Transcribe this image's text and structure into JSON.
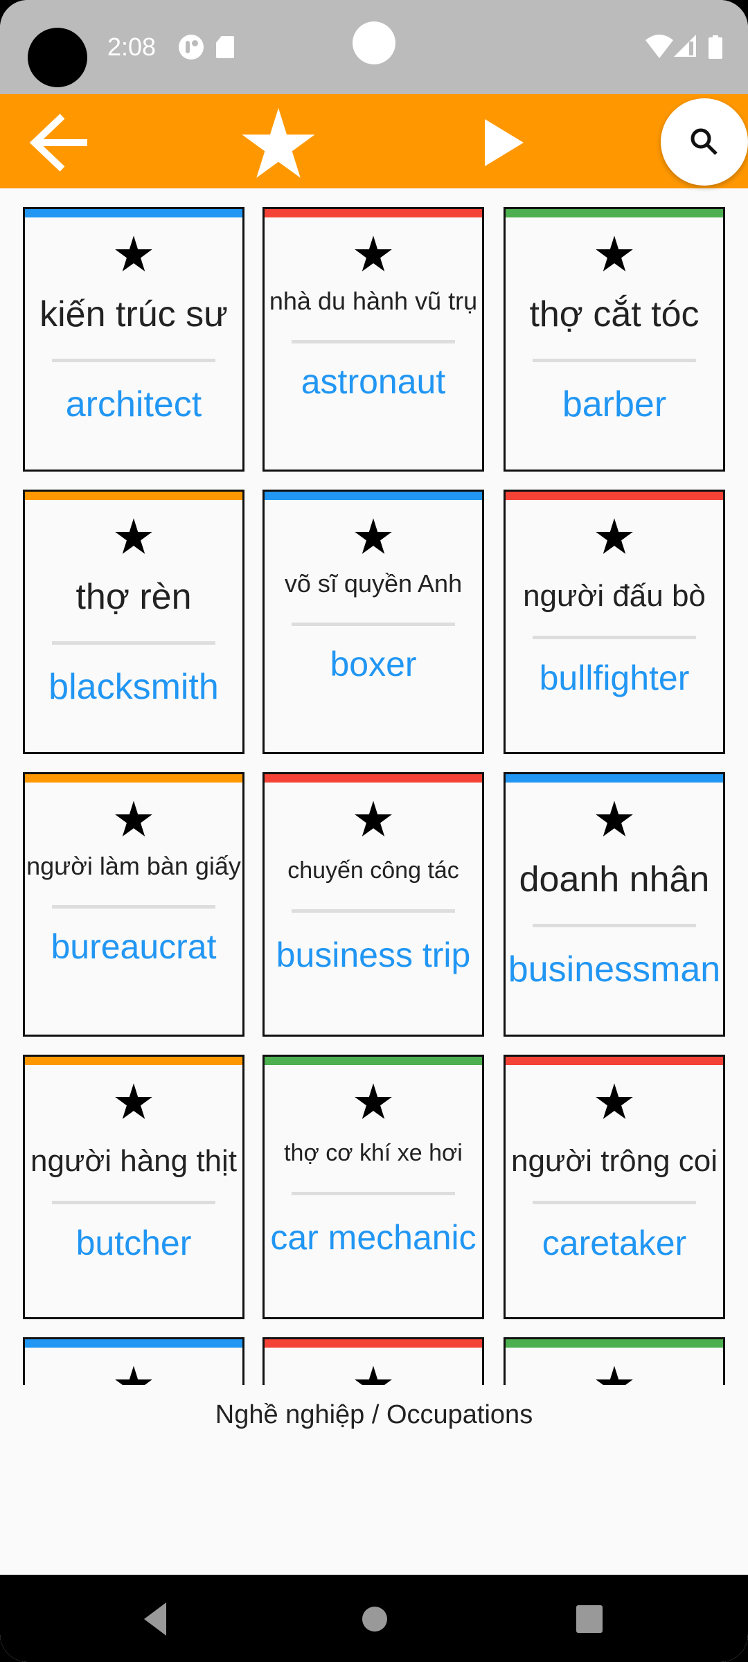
{
  "status_bar": {
    "time": "2:08",
    "icons": [
      "app-notification-icon",
      "sd-card-icon",
      "wifi-icon",
      "cell-signal-icon",
      "battery-icon"
    ]
  },
  "toolbar": {
    "back_icon": "arrow-left-icon",
    "favorite_icon": "star-icon",
    "play_icon": "play-icon",
    "search_icon": "search-icon",
    "background_color": "#FF9800"
  },
  "colors": {
    "blue": "#2196F3",
    "red": "#F44336",
    "green": "#4CAF50",
    "orange": "#FF9800",
    "english_text": "#2196F3"
  },
  "cards": [
    {
      "vi": "kiến trúc sư",
      "en": "architect",
      "color": "#2196F3",
      "size": "l"
    },
    {
      "vi": "nhà du hành vũ trụ",
      "en": "astronaut",
      "color": "#F44336",
      "size": "s"
    },
    {
      "vi": "thợ cắt tóc",
      "en": "barber",
      "color": "#4CAF50",
      "size": "l"
    },
    {
      "vi": "thợ rèn",
      "en": "blacksmith",
      "color": "#FF9800",
      "size": "l"
    },
    {
      "vi": "võ sĩ quyền Anh",
      "en": "boxer",
      "color": "#2196F3",
      "size": "s"
    },
    {
      "vi": "người đấu bò",
      "en": "bullfighter",
      "color": "#F44336",
      "size": "m"
    },
    {
      "vi": "người làm bàn giấy",
      "en": "bureaucrat",
      "color": "#FF9800",
      "size": "s"
    },
    {
      "vi": "chuyến công tác",
      "en": "business trip",
      "color": "#F44336",
      "size": "xs"
    },
    {
      "vi": "doanh nhân",
      "en": "businessman",
      "color": "#2196F3",
      "size": "l"
    },
    {
      "vi": "người hàng thịt",
      "en": "butcher",
      "color": "#FF9800",
      "size": "m"
    },
    {
      "vi": "thợ cơ khí xe hơi",
      "en": "car mechanic",
      "color": "#4CAF50",
      "size": "xs"
    },
    {
      "vi": "người trông coi",
      "en": "caretaker",
      "color": "#F44336",
      "size": "m"
    },
    {
      "vi": "",
      "en": "",
      "color": "#2196F3",
      "size": "l"
    },
    {
      "vi": "",
      "en": "",
      "color": "#F44336",
      "size": "l"
    },
    {
      "vi": "",
      "en": "",
      "color": "#4CAF50",
      "size": "l"
    }
  ],
  "caption": "Nghề nghiệp / Occupations",
  "nav_bar": {
    "back": "nav-back-icon",
    "home": "nav-home-icon",
    "recents": "nav-recents-icon"
  }
}
